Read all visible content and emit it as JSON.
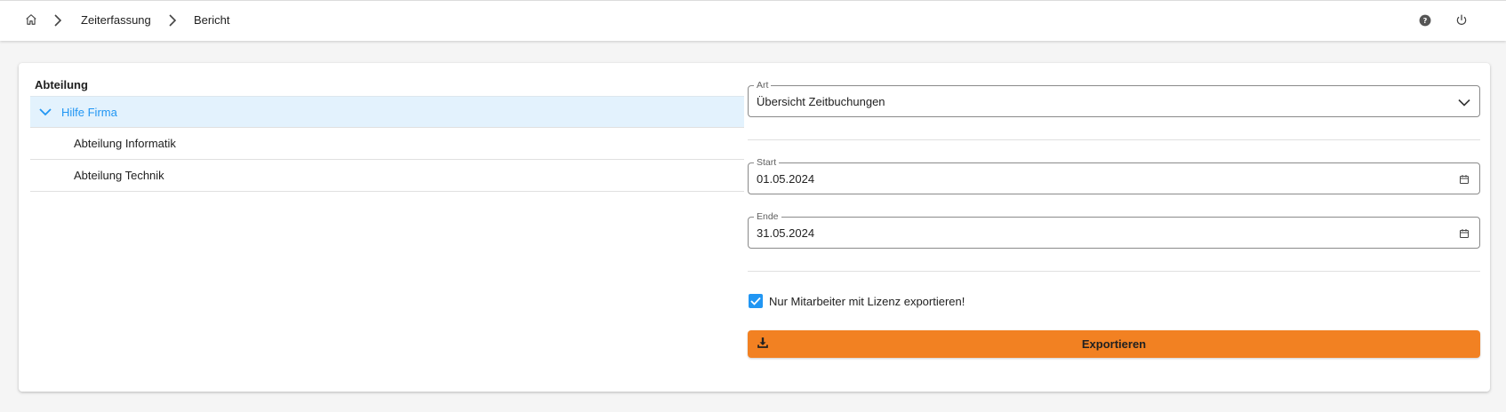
{
  "breadcrumb": {
    "home_icon": "home-icon",
    "items": [
      {
        "label": "Zeiterfassung"
      },
      {
        "label": "Bericht"
      }
    ]
  },
  "header_actions": {
    "help_icon": "help-circle-icon",
    "power_icon": "power-icon"
  },
  "department_tree": {
    "title": "Abteilung",
    "root": {
      "label": "Hilfe Firma",
      "expanded": true,
      "selected": true
    },
    "children": [
      {
        "label": "Abteilung Informatik"
      },
      {
        "label": "Abteilung Technik"
      }
    ]
  },
  "form": {
    "type": {
      "label": "Art",
      "value": "Übersicht Zeitbuchungen"
    },
    "start": {
      "label": "Start",
      "value": "01.05.2024"
    },
    "end": {
      "label": "Ende",
      "value": "31.05.2024"
    },
    "license_only": {
      "label": "Nur Mitarbeiter mit Lizenz exportieren!",
      "checked": true
    },
    "export_button": {
      "label": "Exportieren",
      "icon": "download-icon"
    }
  },
  "colors": {
    "accent": "#f28122",
    "selected_bg": "#e3f2fd",
    "selected_text": "#2196f3",
    "checkbox": "#2196f3"
  }
}
